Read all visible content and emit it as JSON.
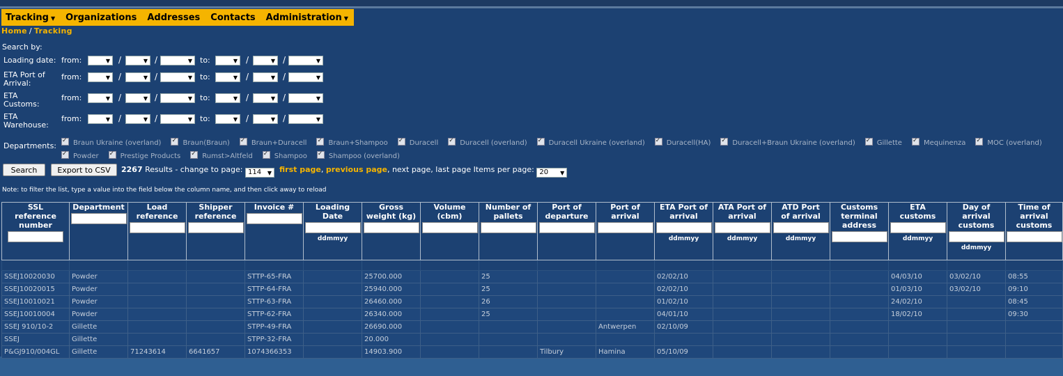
{
  "nav": {
    "items": [
      {
        "label": "Tracking",
        "dropdown": true
      },
      {
        "label": "Organizations",
        "dropdown": false
      },
      {
        "label": "Addresses",
        "dropdown": false
      },
      {
        "label": "Contacts",
        "dropdown": false
      },
      {
        "label": "Administration",
        "dropdown": true
      }
    ],
    "caret": "▼"
  },
  "breadcrumb": {
    "home": "Home",
    "sep": "/",
    "current": "Tracking"
  },
  "search": {
    "heading": "Search by:",
    "from": "from:",
    "to": "to:",
    "slash": "/",
    "rows": [
      {
        "label": "Loading date:"
      },
      {
        "label_line1": "ETA Port of",
        "label_line2": "Arrival:"
      },
      {
        "label_line1": "ETA",
        "label_line2": "Customs:"
      },
      {
        "label_line1": "ETA",
        "label_line2": "Warehouse:"
      }
    ]
  },
  "departments": {
    "label": "Departments:",
    "items": [
      "Braun Ukraine (overland)",
      "Braun(Braun)",
      "Braun+Duracell",
      "Braun+Shampoo",
      "Duracell",
      "Duracell (overland)",
      "Duracell Ukraine (overland)",
      "Duracell(HA)",
      "Duracell+Braun Ukraine (overland)",
      "Gillette",
      "Mequinenza",
      "MOC (overland)",
      "Powder",
      "Prestige Products",
      "Rumst>Altfeld",
      "Shampoo",
      "Shampoo (overland)"
    ]
  },
  "toolbar": {
    "search_label": "Search",
    "export_label": "Export to CSV",
    "result_count": "2267",
    "results_text": " Results - change to page: ",
    "page_value": "114",
    "first_page": "first page",
    "comma": ",",
    "previous_page": "previous page",
    "next_last": ", next page, last page Items per page: ",
    "per_page": "20"
  },
  "note": "Note: to filter the list, type a value into the field below the column name, and then click away to reload",
  "table": {
    "date_format": "ddmmyy",
    "columns": [
      {
        "line1": "SSL",
        "line2": "reference",
        "line3": "number"
      },
      {
        "line1": "Department"
      },
      {
        "line1": "Load",
        "line2": "reference"
      },
      {
        "line1": "Shipper",
        "line2": "reference"
      },
      {
        "line1": "Invoice #"
      },
      {
        "line1": "Loading",
        "line2": "Date"
      },
      {
        "line1": "Gross",
        "line2": "weight (kg)"
      },
      {
        "line1": "Volume",
        "line2": "(cbm)"
      },
      {
        "line1": "Number of",
        "line2": "pallets"
      },
      {
        "line1": "Port of",
        "line2": "departure"
      },
      {
        "line1": "Port of",
        "line2": "arrival"
      },
      {
        "line1": "ETA Port of",
        "line2": "arrival"
      },
      {
        "line1": "ATA Port of",
        "line2": "arrival"
      },
      {
        "line1": "ATD Port",
        "line2": "of arrival"
      },
      {
        "line1": "Customs",
        "line2": "terminal",
        "line3": "address"
      },
      {
        "line1": "ETA",
        "line2": "customs"
      },
      {
        "line1": "Day of",
        "line2": "arrival",
        "line3": "customs"
      },
      {
        "line1": "Time of",
        "line2": "arrival",
        "line3": "customs"
      }
    ],
    "rows": [
      [
        "SSEJ10020030",
        "Powder",
        "",
        "",
        "STTP-65-FRA",
        "",
        "25700.000",
        "",
        "25",
        "",
        "",
        "02/02/10",
        "",
        "",
        "",
        "04/03/10",
        "03/02/10",
        "08:55"
      ],
      [
        "SSEJ10020015",
        "Powder",
        "",
        "",
        "STTP-64-FRA",
        "",
        "25940.000",
        "",
        "25",
        "",
        "",
        "02/02/10",
        "",
        "",
        "",
        "01/03/10",
        "03/02/10",
        "09:10"
      ],
      [
        "SSEJ10010021",
        "Powder",
        "",
        "",
        "STTP-63-FRA",
        "",
        "26460.000",
        "",
        "26",
        "",
        "",
        "01/02/10",
        "",
        "",
        "",
        "24/02/10",
        "",
        "08:45"
      ],
      [
        "SSEJ10010004",
        "Powder",
        "",
        "",
        "STTP-62-FRA",
        "",
        "26340.000",
        "",
        "25",
        "",
        "",
        "04/01/10",
        "",
        "",
        "",
        "18/02/10",
        "",
        "09:30"
      ],
      [
        "SSEJ 910/10-2",
        "Gillette",
        "",
        "",
        "STPP-49-FRA",
        "",
        "26690.000",
        "",
        "",
        "",
        "Antwerpen",
        "02/10/09",
        "",
        "",
        "",
        "",
        "",
        ""
      ],
      [
        "SSEJ",
        "Gillette",
        "",
        "",
        "STPP-32-FRA",
        "",
        "20.000",
        "",
        "",
        "",
        "",
        "",
        "",
        "",
        "",
        "",
        "",
        ""
      ],
      [
        "P&GJ910/004GL",
        "Gillette",
        "71243614",
        "6641657",
        "1074366353",
        "",
        "14903.900",
        "",
        "",
        "Tilbury",
        "Hamina",
        "05/10/09",
        "",
        "",
        "",
        "",
        "",
        ""
      ]
    ]
  }
}
